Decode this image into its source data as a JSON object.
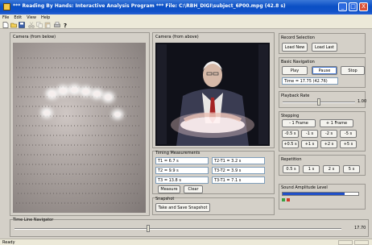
{
  "window": {
    "title": "*** Reading By Hands: Interactive Analysis Program ***   File: C:\\RBH_DIGI\\subject_6P00.mpg  (42.8 s)",
    "minimize": "_",
    "maximize": "□",
    "close": "X"
  },
  "menu": [
    "File",
    "Edit",
    "View",
    "Help"
  ],
  "toolbar_icons": [
    "new-icon",
    "open-icon",
    "save-icon",
    "cut-icon",
    "copy-icon",
    "paste-icon",
    "print-icon",
    "help-icon"
  ],
  "camera_below": {
    "label": "Camera (from below)"
  },
  "camera_above": {
    "label": "Camera (from above)"
  },
  "record_selection": {
    "label": "Record Selection",
    "load_new": "Load New",
    "load_last": "Load Last"
  },
  "basic_navigation": {
    "label": "Basic Navigation",
    "play": "Play",
    "pause": "Pause",
    "stop": "Stop",
    "time_text": "Time = 17.75 (42.76)"
  },
  "playback_rate": {
    "label": "Playback Rate",
    "value": "1.00",
    "position": 0.5
  },
  "stepping": {
    "label": "Stepping",
    "minus_frame": "- 1 Frame",
    "plus_frame": "+ 1 Frame",
    "row1": [
      "-0.5 s",
      "-1 s",
      "-2 s",
      "-5 s"
    ],
    "row2": [
      "+0.5 s",
      "+1 s",
      "+2 s",
      "+5 s"
    ]
  },
  "timing": {
    "label": "Timing Measurements",
    "t1": "T1 = 6.7 s",
    "t2t1": "T2-T1 = 3.2 s",
    "t2": "T2 = 9.9 s",
    "t3t2": "T3-T2 = 3.9 s",
    "t3": "T3 = 13.8 s",
    "t3t1": "T3-T1 = 7.1 s",
    "measure": "Measure",
    "clear": "Clear"
  },
  "repetition": {
    "label": "Repetition",
    "buttons": [
      "0.5 s",
      "1 s",
      "2 s",
      "5 s"
    ]
  },
  "snapshot": {
    "label": "Snapshot",
    "take": "Take and Save Snapshot"
  },
  "sound": {
    "label": "Sound Amplitude Level",
    "level": 0.82
  },
  "timeline": {
    "label": "Time Line Navigator",
    "value": "17.70",
    "position": 0.41
  },
  "status": {
    "text": "Ready"
  },
  "colors": {
    "titlebar": "#0a4fc4",
    "face": "#d4d0c8",
    "level": "#1f4fc8"
  }
}
